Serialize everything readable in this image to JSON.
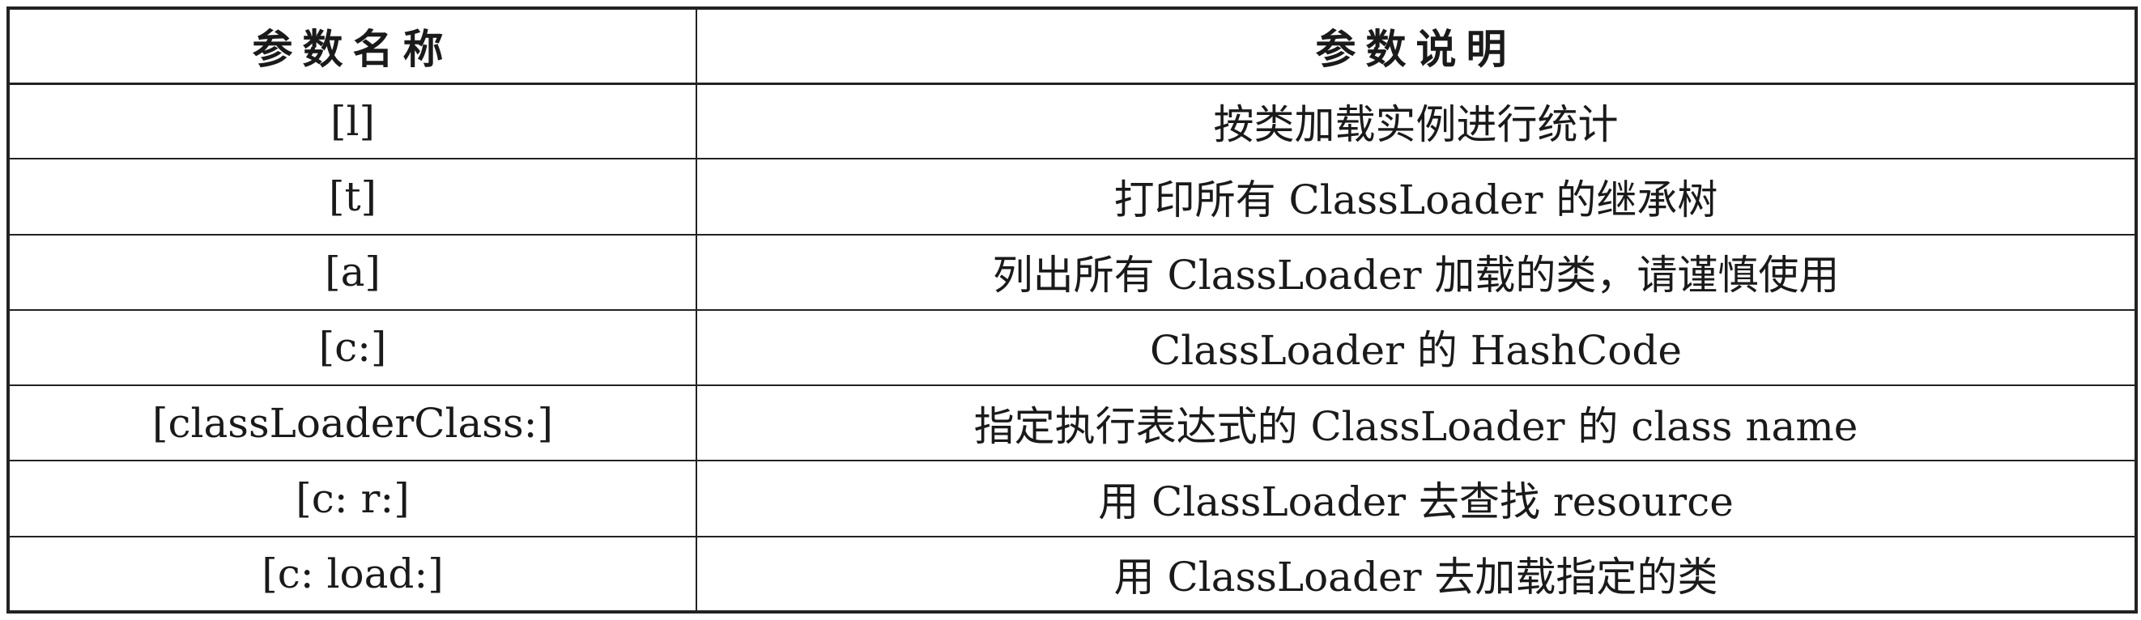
{
  "table": {
    "headers": [
      "参数名称",
      "参数说明"
    ],
    "rows": [
      {
        "name": "[l]",
        "desc": "按类加载实例进行统计"
      },
      {
        "name": "[t]",
        "desc": "打印所有 ClassLoader 的继承树"
      },
      {
        "name": "[a]",
        "desc": "列出所有 ClassLoader 加载的类，请谨慎使用"
      },
      {
        "name": "[c:]",
        "desc": "ClassLoader 的 HashCode"
      },
      {
        "name": "[classLoaderClass:]",
        "desc": "指定执行表达式的 ClassLoader 的 class name"
      },
      {
        "name": "[c: r:]",
        "desc": "用 ClassLoader 去查找 resource"
      },
      {
        "name": "[c: load:]",
        "desc": "用 ClassLoader 去加载指定的类"
      }
    ]
  }
}
